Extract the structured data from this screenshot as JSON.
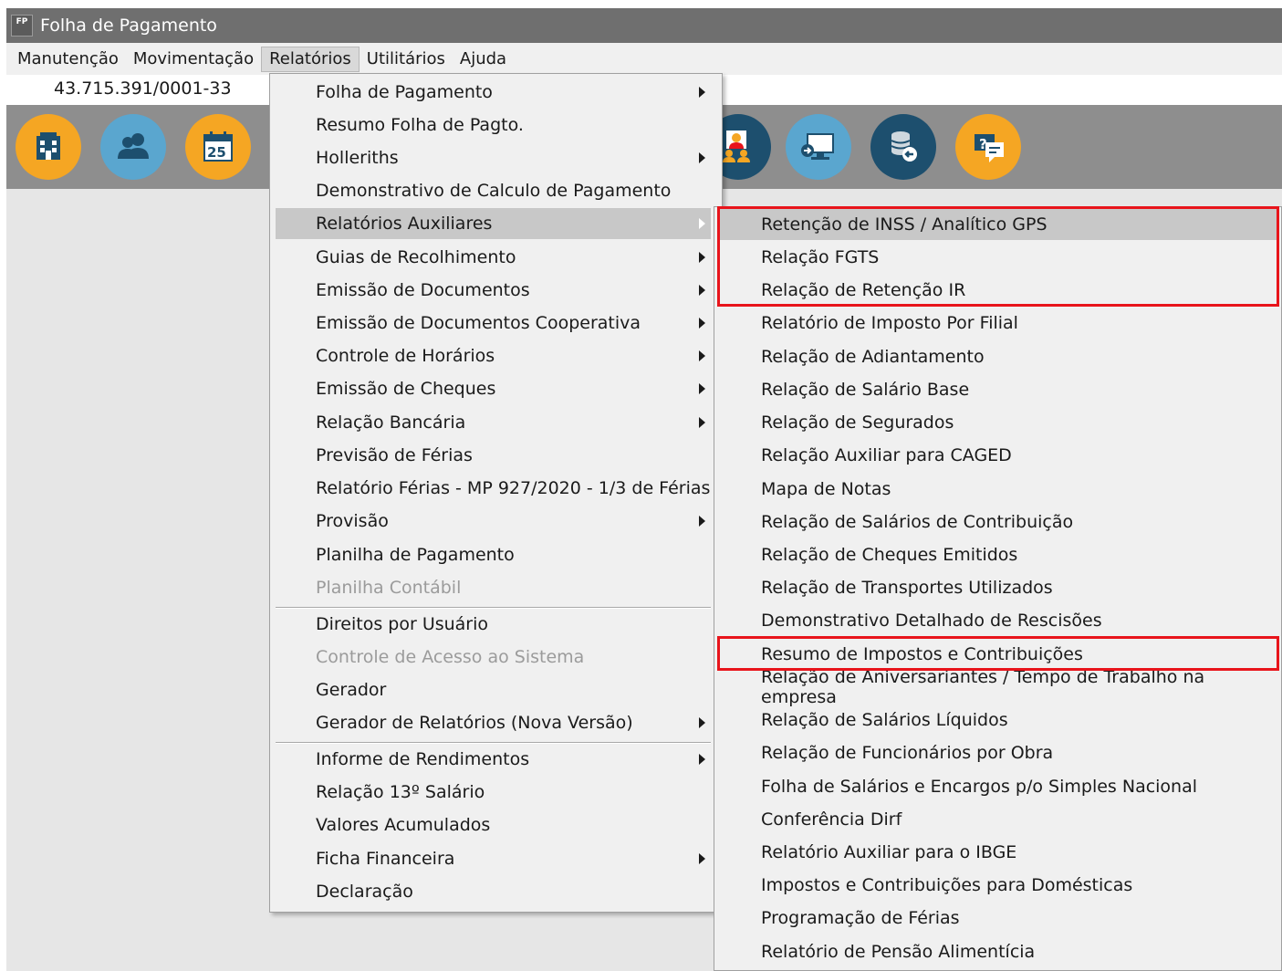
{
  "window": {
    "title": "Folha de Pagamento",
    "icon_text": "FP"
  },
  "menubar": [
    "Manutenção",
    "Movimentação",
    "Relatórios",
    "Utilitários",
    "Ajuda"
  ],
  "cnpj": "43.715.391/0001-33",
  "toolbar_icons": [
    "company-icon",
    "employees-icon",
    "calendar-icon",
    "users-group-icon",
    "remote-access-icon",
    "database-backup-icon",
    "help-support-icon"
  ],
  "calendar_day": "25",
  "help_mark": "?",
  "reports_menu": [
    {
      "label": "Folha de Pagamento",
      "submenu": true
    },
    {
      "label": "Resumo Folha de Pagto.",
      "submenu": false
    },
    {
      "label": "Holleriths",
      "submenu": true
    },
    {
      "label": "Demonstrativo de Calculo de Pagamento",
      "submenu": false
    },
    {
      "label": "Relatórios Auxiliares",
      "submenu": true,
      "highlighted": true
    },
    {
      "label": "Guias de Recolhimento",
      "submenu": true
    },
    {
      "label": "Emissão de Documentos",
      "submenu": true
    },
    {
      "label": "Emissão de Documentos Cooperativa",
      "submenu": true
    },
    {
      "label": "Controle de Horários",
      "submenu": true
    },
    {
      "label": "Emissão de Cheques",
      "submenu": true
    },
    {
      "label": "Relação Bancária",
      "submenu": true
    },
    {
      "label": "Previsão de Férias",
      "submenu": false
    },
    {
      "label": "Relatório Férias - MP 927/2020 - 1/3 de Férias",
      "submenu": false
    },
    {
      "label": "Provisão",
      "submenu": true
    },
    {
      "label": "Planilha de Pagamento",
      "submenu": false
    },
    {
      "label": "Planilha Contábil",
      "submenu": false,
      "disabled": true
    },
    {
      "label": "Direitos por Usuário",
      "submenu": false
    },
    {
      "label": "Controle de Acesso ao Sistema",
      "submenu": false,
      "disabled": true
    },
    {
      "label": "Gerador",
      "submenu": false
    },
    {
      "label": "Gerador de Relatórios (Nova Versão)",
      "submenu": true
    },
    {
      "label": "Informe de Rendimentos",
      "submenu": true
    },
    {
      "label": "Relação 13º Salário",
      "submenu": false
    },
    {
      "label": "Valores Acumulados",
      "submenu": false
    },
    {
      "label": "Ficha Financeira",
      "submenu": true
    },
    {
      "label": "Declaração",
      "submenu": false
    }
  ],
  "aux_reports_menu": [
    {
      "label": "Retenção de INSS / Analítico GPS",
      "highlighted": true
    },
    {
      "label": "Relação FGTS"
    },
    {
      "label": "Relação de Retenção IR"
    },
    {
      "label": "Relatório de Imposto Por Filial"
    },
    {
      "label": "Relação de Adiantamento"
    },
    {
      "label": "Relação de Salário Base"
    },
    {
      "label": "Relação de Segurados"
    },
    {
      "label": "Relação Auxiliar para CAGED"
    },
    {
      "label": "Mapa de Notas"
    },
    {
      "label": "Relação de Salários de Contribuição"
    },
    {
      "label": "Relação de Cheques Emitidos"
    },
    {
      "label": "Relação de Transportes Utilizados"
    },
    {
      "label": "Demonstrativo Detalhado de Rescisões"
    },
    {
      "label": "Resumo de Impostos e Contribuições"
    },
    {
      "label": "Relação de Aniversariantes / Tempo de Trabalho na empresa"
    },
    {
      "label": "Relação de Salários Líquidos"
    },
    {
      "label": "Relação de Funcionários por Obra"
    },
    {
      "label": "Folha de Salários e Encargos p/o Simples Nacional"
    },
    {
      "label": "Conferência Dirf"
    },
    {
      "label": "Relatório Auxiliar para o IBGE"
    },
    {
      "label": "Impostos e Contribuições para Domésticas"
    },
    {
      "label": "Programação de Férias"
    },
    {
      "label": "Relatório de Pensão Alimentícia"
    }
  ],
  "colors": {
    "annotation_red": "#e8141b",
    "toolbar_bg": "#8e8e8e",
    "icon_orange": "#f5a623",
    "icon_blue": "#5aa6cf",
    "icon_navy": "#1d4f6e"
  }
}
